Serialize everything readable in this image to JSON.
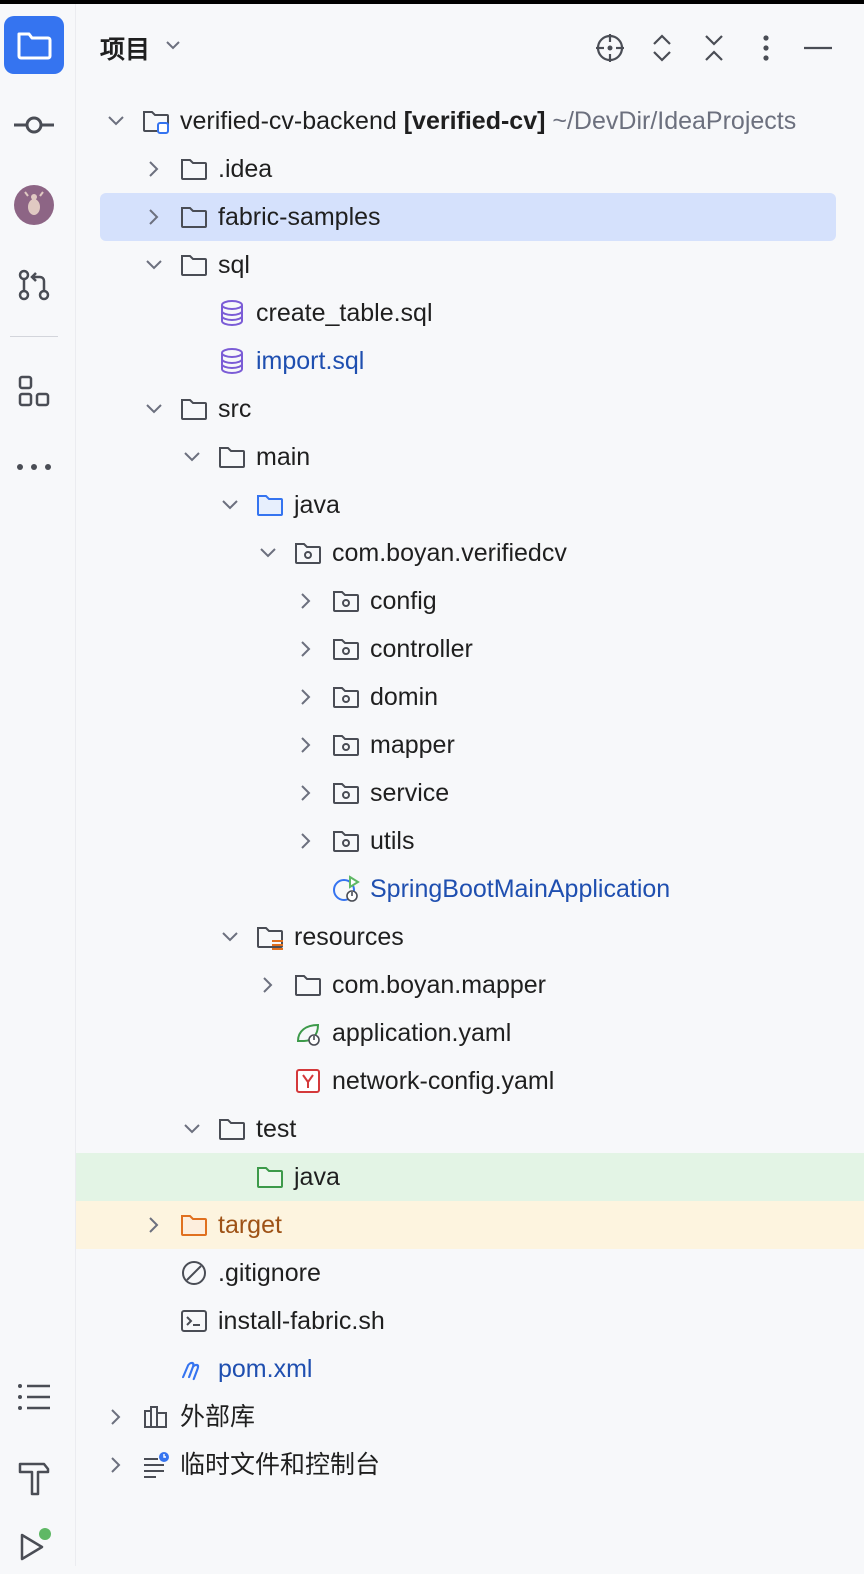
{
  "header": {
    "title": "项目"
  },
  "rail": {
    "items": [
      "project",
      "commit",
      "plugin",
      "pull-requests",
      "structure",
      "more",
      "todo",
      "build",
      "run"
    ]
  },
  "tree": {
    "root": {
      "name": "verified-cv-backend",
      "module": "[verified-cv]",
      "path": "~/DevDir/IdeaProjects"
    },
    "idea": ".idea",
    "fabric_samples": "fabric-samples",
    "sql": "sql",
    "create_table": "create_table.sql",
    "import_sql": "import.sql",
    "src": "src",
    "main": "main",
    "java": "java",
    "package": "com.boyan.verifiedcv",
    "config": "config",
    "controller": "controller",
    "domin": "domin",
    "mapper": "mapper",
    "service": "service",
    "utils": "utils",
    "app_class": "SpringBootMainApplication",
    "resources": "resources",
    "res_mapper": "com.boyan.mapper",
    "application_yaml": "application.yaml",
    "network_config": "network-config.yaml",
    "test": "test",
    "test_java": "java",
    "target": "target",
    "gitignore": ".gitignore",
    "install_fabric": "install-fabric.sh",
    "pom": "pom.xml",
    "external_libs": "外部库",
    "scratches": "临时文件和控制台"
  },
  "colors": {
    "selection": "#d5e1fc",
    "test_bg": "#e3f4e5",
    "excluded_bg": "#fdf4df",
    "accent": "#3574f0"
  }
}
